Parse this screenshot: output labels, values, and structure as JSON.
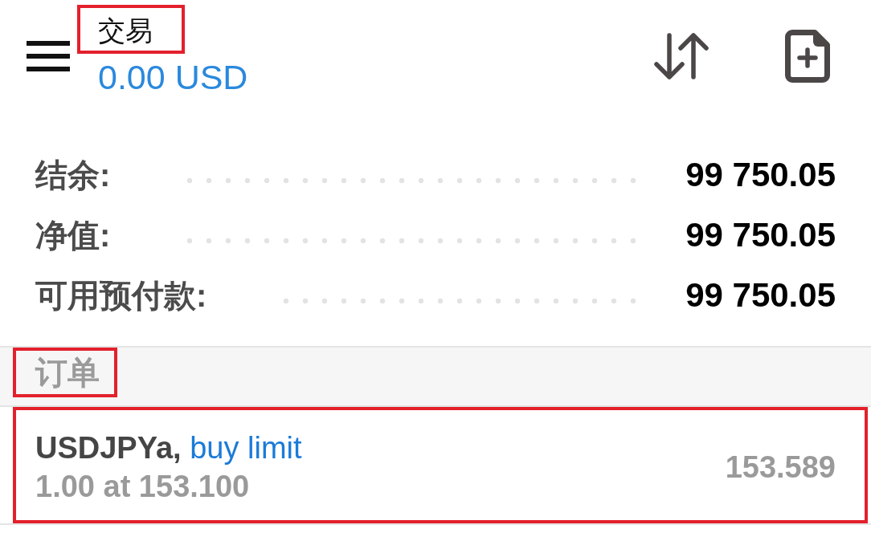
{
  "header": {
    "title": {
      "text": "交易",
      "highlighted": true
    },
    "balance": "0.00 USD"
  },
  "account_summary": [
    {
      "label": "结余:",
      "value": "99 750.05"
    },
    {
      "label": "净值:",
      "value": "99 750.05"
    },
    {
      "label": "可用预付款:",
      "value": "99 750.05"
    }
  ],
  "orders_section": {
    "title": {
      "text": "订单",
      "highlighted": true
    },
    "orders": [
      {
        "symbol": "USDJPYa,",
        "type": "buy limit",
        "kind": "buy",
        "details": "1.00 at 153.100",
        "price": "153.589",
        "highlighted": true
      }
    ]
  }
}
